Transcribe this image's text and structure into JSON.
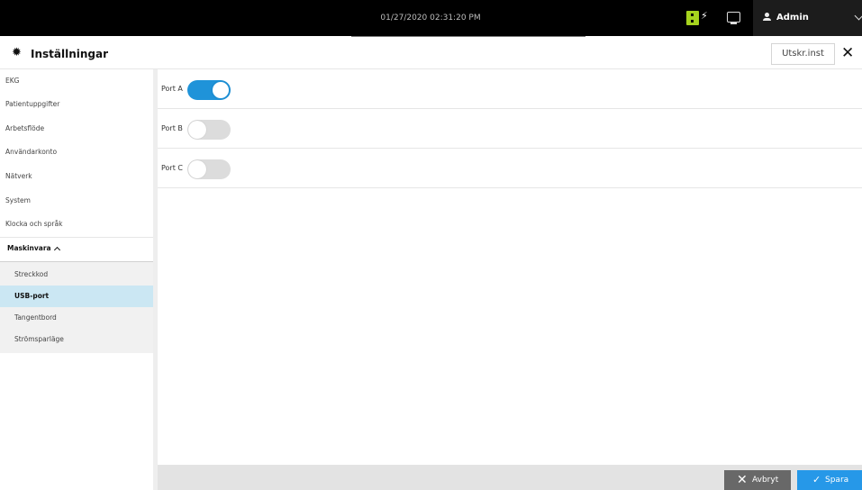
{
  "topbar": {
    "datetime": "01/27/2020 02:31:20 PM",
    "user": "Admin",
    "icons": [
      "battery-icon",
      "bolt-icon",
      "monitor-icon",
      "user-icon",
      "chevron-down-icon"
    ]
  },
  "header": {
    "title": "Inställningar",
    "print_label": "Utskr.inst",
    "icons": [
      "gear-icon",
      "close-icon"
    ]
  },
  "sidebar": {
    "items": [
      {
        "label": "EKG"
      },
      {
        "label": "Patientuppgifter"
      },
      {
        "label": "Arbetsflöde"
      },
      {
        "label": "Användarkonto"
      },
      {
        "label": "Nätverk"
      },
      {
        "label": "System"
      },
      {
        "label": "Klocka och språk"
      }
    ],
    "group": {
      "label": "Maskinvara",
      "expanded": true,
      "subitems": [
        {
          "label": "Streckkod",
          "selected": false
        },
        {
          "label": "USB-port",
          "selected": true
        },
        {
          "label": "Tangentbord",
          "selected": false
        },
        {
          "label": "Strömsparläge",
          "selected": false
        }
      ]
    }
  },
  "ports": [
    {
      "label": "Port A",
      "enabled": true
    },
    {
      "label": "Port B",
      "enabled": false
    },
    {
      "label": "Port C",
      "enabled": false
    }
  ],
  "footer": {
    "cancel_label": "Avbryt",
    "save_label": "Spara"
  },
  "colors": {
    "accent": "#1f93d9",
    "selected_bg": "#cbe7f3",
    "topbar_bg": "#000000",
    "cancel_bg": "#686868",
    "save_bg": "#2698e8"
  }
}
